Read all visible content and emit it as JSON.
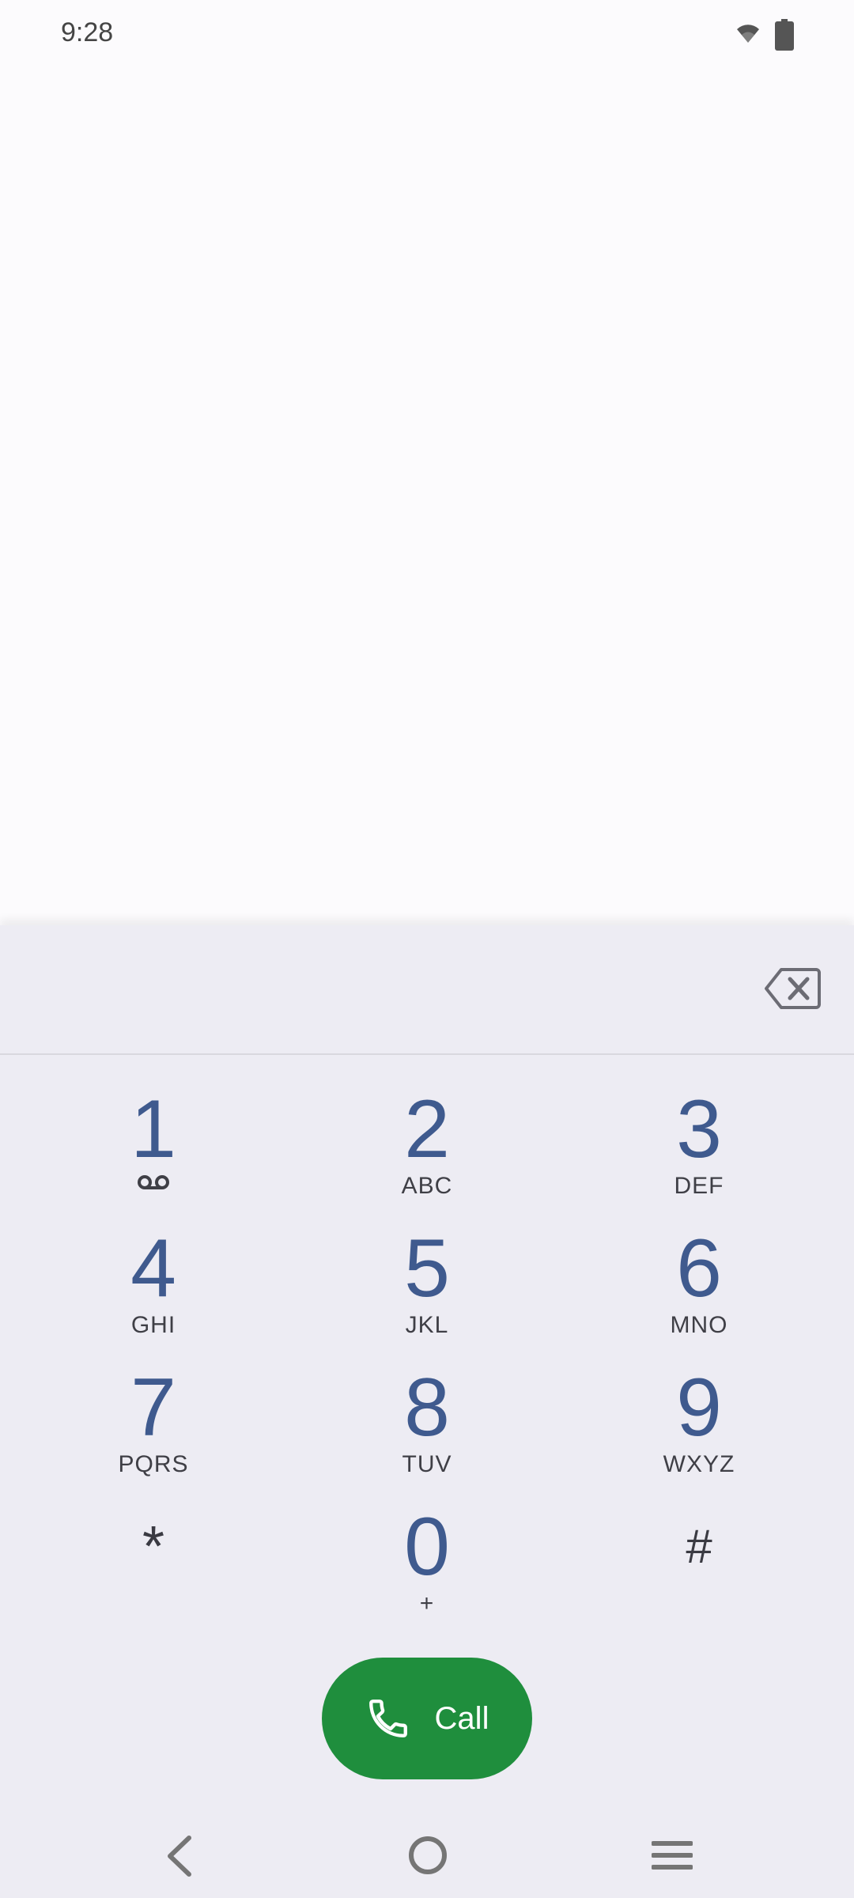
{
  "status_bar": {
    "time": "9:28",
    "icons": [
      "wifi-icon",
      "battery-icon"
    ]
  },
  "dialpad": {
    "digits_value": "",
    "backspace_icon": "backspace-icon",
    "keys": [
      {
        "digit": "1",
        "letters": "",
        "icon": "voicemail-icon"
      },
      {
        "digit": "2",
        "letters": "ABC"
      },
      {
        "digit": "3",
        "letters": "DEF"
      },
      {
        "digit": "4",
        "letters": "GHI"
      },
      {
        "digit": "5",
        "letters": "JKL"
      },
      {
        "digit": "6",
        "letters": "MNO"
      },
      {
        "digit": "7",
        "letters": "PQRS"
      },
      {
        "digit": "8",
        "letters": "TUV"
      },
      {
        "digit": "9",
        "letters": "WXYZ"
      },
      {
        "digit": "*",
        "letters": ""
      },
      {
        "digit": "0",
        "letters": "+"
      },
      {
        "digit": "#",
        "letters": ""
      }
    ],
    "call_label": "Call",
    "call_color": "#1f8e3d",
    "digit_color": "#3f5a8e"
  },
  "nav_bar": {
    "icons": [
      "back-icon",
      "home-icon",
      "recents-icon"
    ]
  }
}
